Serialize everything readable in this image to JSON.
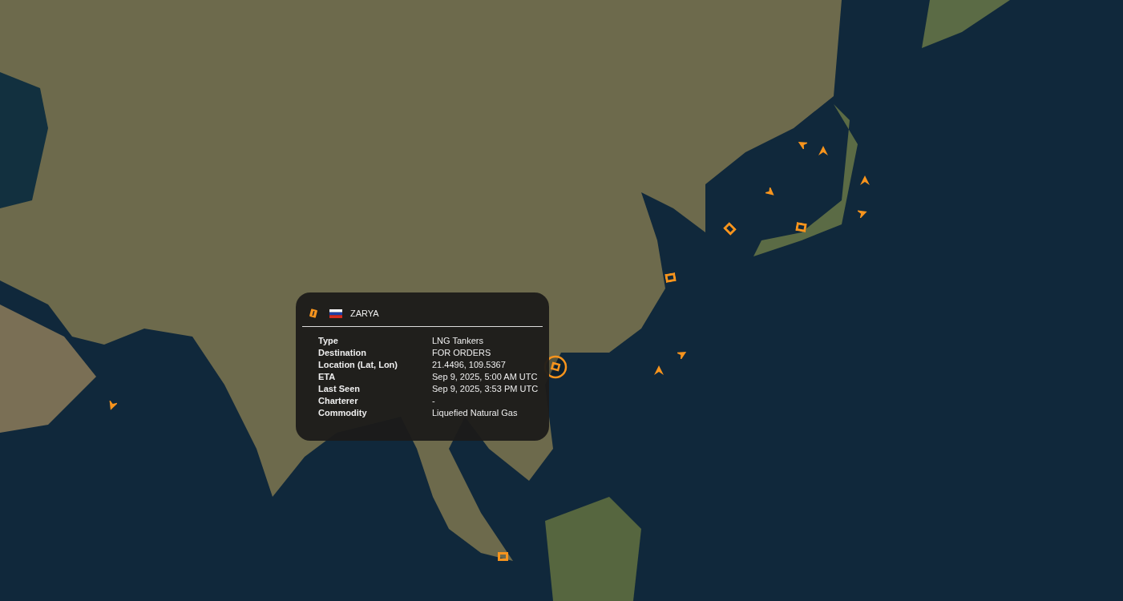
{
  "vessel_popup": {
    "name": "ZARYA",
    "details": [
      {
        "label": "Type",
        "value": "LNG Tankers"
      },
      {
        "label": "Destination",
        "value": "FOR ORDERS"
      },
      {
        "label": "Location (Lat, Lon)",
        "value": "21.4496, 109.5367"
      },
      {
        "label": "ETA",
        "value": "Sep 9, 2025, 5:00 AM UTC"
      },
      {
        "label": "Last Seen",
        "value": "Sep 9, 2025, 3:53 PM UTC"
      },
      {
        "label": "Charterer",
        "value": "-"
      },
      {
        "label": "Commodity",
        "value": "Liquefied Natural Gas"
      }
    ]
  }
}
